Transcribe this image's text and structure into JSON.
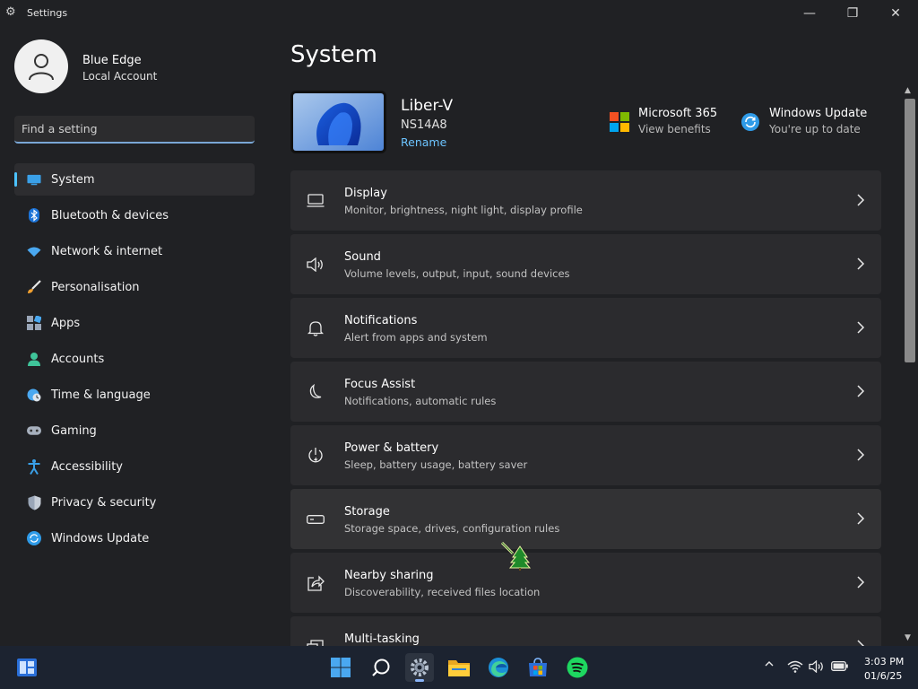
{
  "window": {
    "title": "Settings",
    "controls": {
      "minimize": "—",
      "maximize": "❐",
      "close": "✕"
    }
  },
  "profile": {
    "name": "Blue Edge",
    "account_type": "Local Account"
  },
  "search": {
    "placeholder": "Find a setting"
  },
  "nav": {
    "items": [
      {
        "label": "System",
        "icon": "system-icon",
        "active": true
      },
      {
        "label": "Bluetooth & devices",
        "icon": "bluetooth-icon"
      },
      {
        "label": "Network & internet",
        "icon": "wifi-icon"
      },
      {
        "label": "Personalisation",
        "icon": "brush-icon"
      },
      {
        "label": "Apps",
        "icon": "apps-icon"
      },
      {
        "label": "Accounts",
        "icon": "accounts-icon"
      },
      {
        "label": "Time & language",
        "icon": "globe-clock-icon"
      },
      {
        "label": "Gaming",
        "icon": "gamepad-icon"
      },
      {
        "label": "Accessibility",
        "icon": "accessibility-icon"
      },
      {
        "label": "Privacy & security",
        "icon": "shield-icon"
      },
      {
        "label": "Windows Update",
        "icon": "update-icon"
      }
    ]
  },
  "main": {
    "title": "System",
    "device": {
      "name": "Liber-V",
      "model": "NS14A8",
      "rename_label": "Rename"
    },
    "tiles": {
      "m365": {
        "title": "Microsoft 365",
        "subtitle": "View benefits"
      },
      "update": {
        "title": "Windows Update",
        "subtitle": "You're up to date"
      }
    },
    "rows": [
      {
        "title": "Display",
        "subtitle": "Monitor, brightness, night light, display profile",
        "icon": "display-icon"
      },
      {
        "title": "Sound",
        "subtitle": "Volume levels, output, input, sound devices",
        "icon": "speaker-icon"
      },
      {
        "title": "Notifications",
        "subtitle": "Alert from apps and system",
        "icon": "bell-icon"
      },
      {
        "title": "Focus Assist",
        "subtitle": "Notifications, automatic rules",
        "icon": "moon-icon"
      },
      {
        "title": "Power & battery",
        "subtitle": "Sleep, battery usage, battery saver",
        "icon": "power-icon"
      },
      {
        "title": "Storage",
        "subtitle": "Storage space, drives, configuration rules",
        "icon": "storage-icon"
      },
      {
        "title": "Nearby sharing",
        "subtitle": "Discoverability, received files location",
        "icon": "share-icon"
      },
      {
        "title": "Multi-tasking",
        "subtitle": "",
        "icon": "multitask-icon"
      }
    ]
  },
  "taskbar": {
    "clock": {
      "time": "3:03 PM",
      "date": "01/6/25"
    }
  },
  "colors": {
    "accent": "#4cc2ff",
    "link": "#6cc4ff",
    "background": "#202124",
    "card": "#2b2b2e",
    "taskbar": "#1c2330"
  }
}
